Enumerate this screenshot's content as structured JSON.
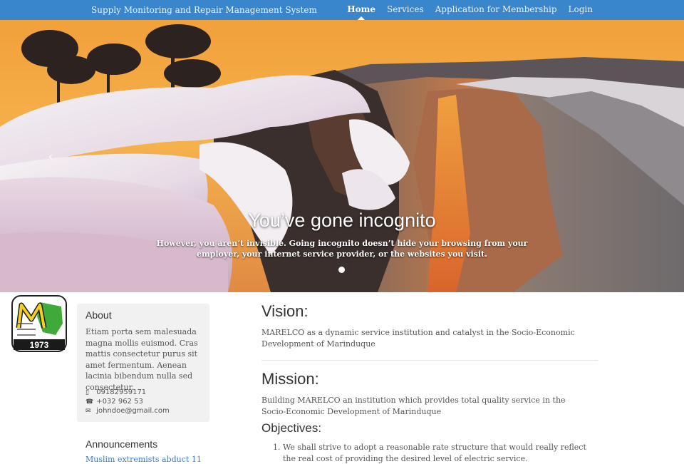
{
  "navbar": {
    "brand": "Supply Monitoring and Repair Management System",
    "items": [
      {
        "label": "Home",
        "active": true
      },
      {
        "label": "Services",
        "active": false
      },
      {
        "label": "Application for Membership",
        "active": false
      },
      {
        "label": "Login",
        "active": false
      }
    ],
    "color": "#3a86cc"
  },
  "carousel": {
    "title": "You’ve gone incognito",
    "caption": "However, you aren’t invisible. Going incognito doesn’t hide your browsing from your employer, your internet service provider, or the websites you visit.",
    "prev_icon": "chevron-left-icon",
    "slides_count": 1,
    "active_slide": 1
  },
  "logo": {
    "year": "1973",
    "letter": "M"
  },
  "sidebar": {
    "about": {
      "title": "About",
      "text": "Etiam porta sem malesuada magna mollis euismod. Cras mattis consectetur purus sit amet fermentum. Aenean lacinia bibendum nulla sed consectetur.",
      "mobile": "09182959171",
      "phone": "+032 962 53",
      "email": "johndoe@gmail.com"
    },
    "announcements": {
      "title": "Announcements",
      "first_link": "Muslim extremists abduct 11"
    }
  },
  "main": {
    "vision": {
      "title": "Vision:",
      "text": "MARELCO as a dynamic service institution and catalyst in the Socio-Economic Development of Marinduque"
    },
    "mission": {
      "title": "Mission:",
      "text": "Building MARELCO an institution which provides total quality service in the Socio-Economic Development of Marinduque"
    },
    "objectives": {
      "title": "Objectives:",
      "items": [
        "We shall strive to adopt a reasonable rate structure that would really reflect the real cost of providing the desired level of electric service."
      ]
    }
  }
}
